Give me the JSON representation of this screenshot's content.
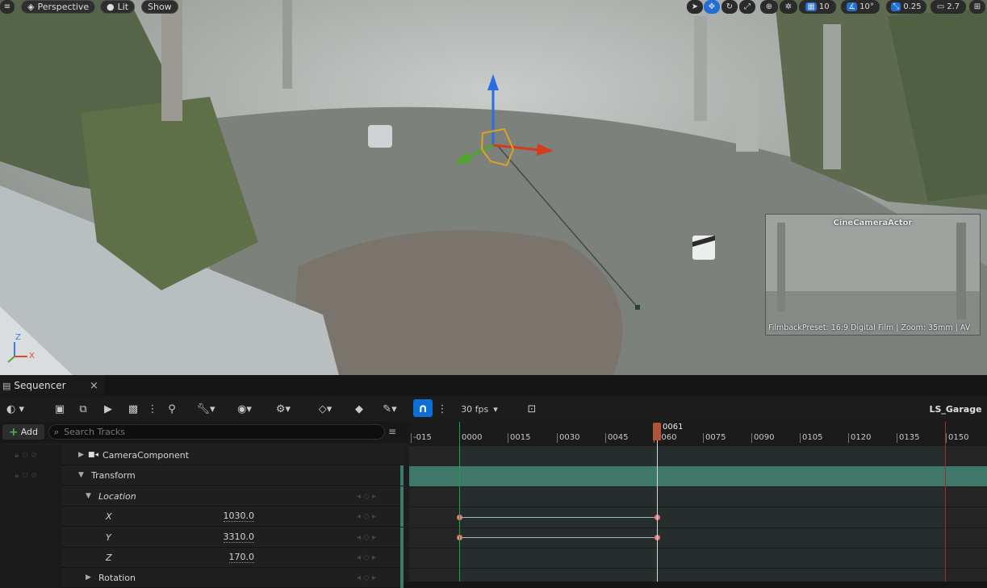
{
  "viewport": {
    "buttons": {
      "perspective": "Perspective",
      "lit": "Lit",
      "show": "Show"
    },
    "toolbar_values": {
      "grid_snap": "10",
      "rotation_snap": "10°",
      "scale_snap": "0.25",
      "camera_speed": "2.7"
    },
    "preview": {
      "title": "CineCameraActor",
      "footer": "FilmbackPreset: 16:9 Digital Film | Zoom: 35mm | AV"
    },
    "axis": {
      "z": "Z",
      "x": "X"
    }
  },
  "sequencer": {
    "tab_label": "Sequencer",
    "tab_close": "×",
    "fps": "30 fps",
    "sequence_name": "LS_Garage",
    "add_label": "Add",
    "search_placeholder": "Search Tracks",
    "playhead_frame": "0061",
    "ticks": [
      "-015",
      "0000",
      "0015",
      "0030",
      "0045",
      "0060",
      "0075",
      "0090",
      "0105",
      "0120",
      "0135",
      "0150"
    ],
    "tracks": [
      {
        "name": "CameraComponent"
      },
      {
        "name": "Transform"
      },
      {
        "name": "Location"
      },
      {
        "name": "X",
        "value": "1030.0"
      },
      {
        "name": "Y",
        "value": "3310.0"
      },
      {
        "name": "Z",
        "value": "170.0"
      },
      {
        "name": "Rotation"
      }
    ]
  },
  "colors": {
    "accent": "#0d6fd6",
    "keyframe": "#ee7b77",
    "transform_bar": "#3f776b",
    "playhead": "#b0533a"
  }
}
